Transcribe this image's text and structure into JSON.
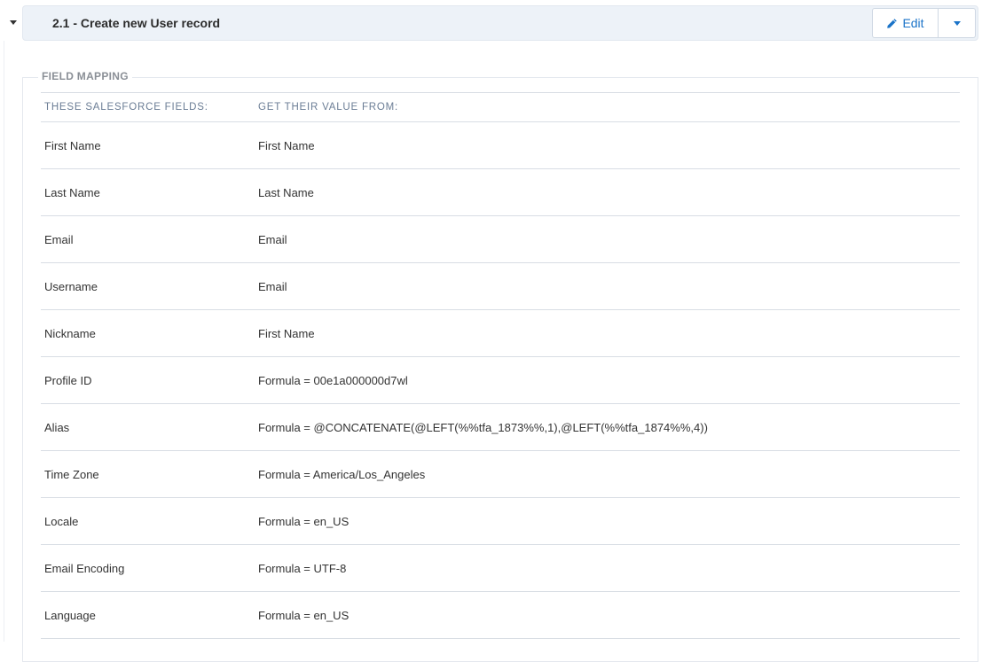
{
  "header": {
    "title": "2.1 - Create new User record",
    "edit_label": "Edit"
  },
  "field_mapping": {
    "legend": "FIELD MAPPING",
    "columns": [
      "THESE SALESFORCE FIELDS:",
      "GET THEIR VALUE FROM:"
    ],
    "rows": [
      {
        "field": "First Name",
        "value": "First Name"
      },
      {
        "field": "Last Name",
        "value": "Last Name"
      },
      {
        "field": "Email",
        "value": "Email"
      },
      {
        "field": "Username",
        "value": "Email"
      },
      {
        "field": "Nickname",
        "value": "First Name"
      },
      {
        "field": "Profile ID",
        "value": "Formula = 00e1a000000d7wl"
      },
      {
        "field": "Alias",
        "value": "Formula = @CONCATENATE(@LEFT(%%tfa_1873%%,1),@LEFT(%%tfa_1874%%,4))"
      },
      {
        "field": "Time Zone",
        "value": "Formula = America/Los_Angeles"
      },
      {
        "field": "Locale",
        "value": "Formula = en_US"
      },
      {
        "field": "Email Encoding",
        "value": "Formula = UTF-8"
      },
      {
        "field": "Language",
        "value": "Formula = en_US"
      }
    ]
  },
  "colors": {
    "accent": "#1a73c8",
    "header_bg": "#edf2f8"
  },
  "icons": {
    "collapse": "caret-down-icon",
    "edit": "pencil-icon",
    "dropdown": "caret-down-icon"
  }
}
